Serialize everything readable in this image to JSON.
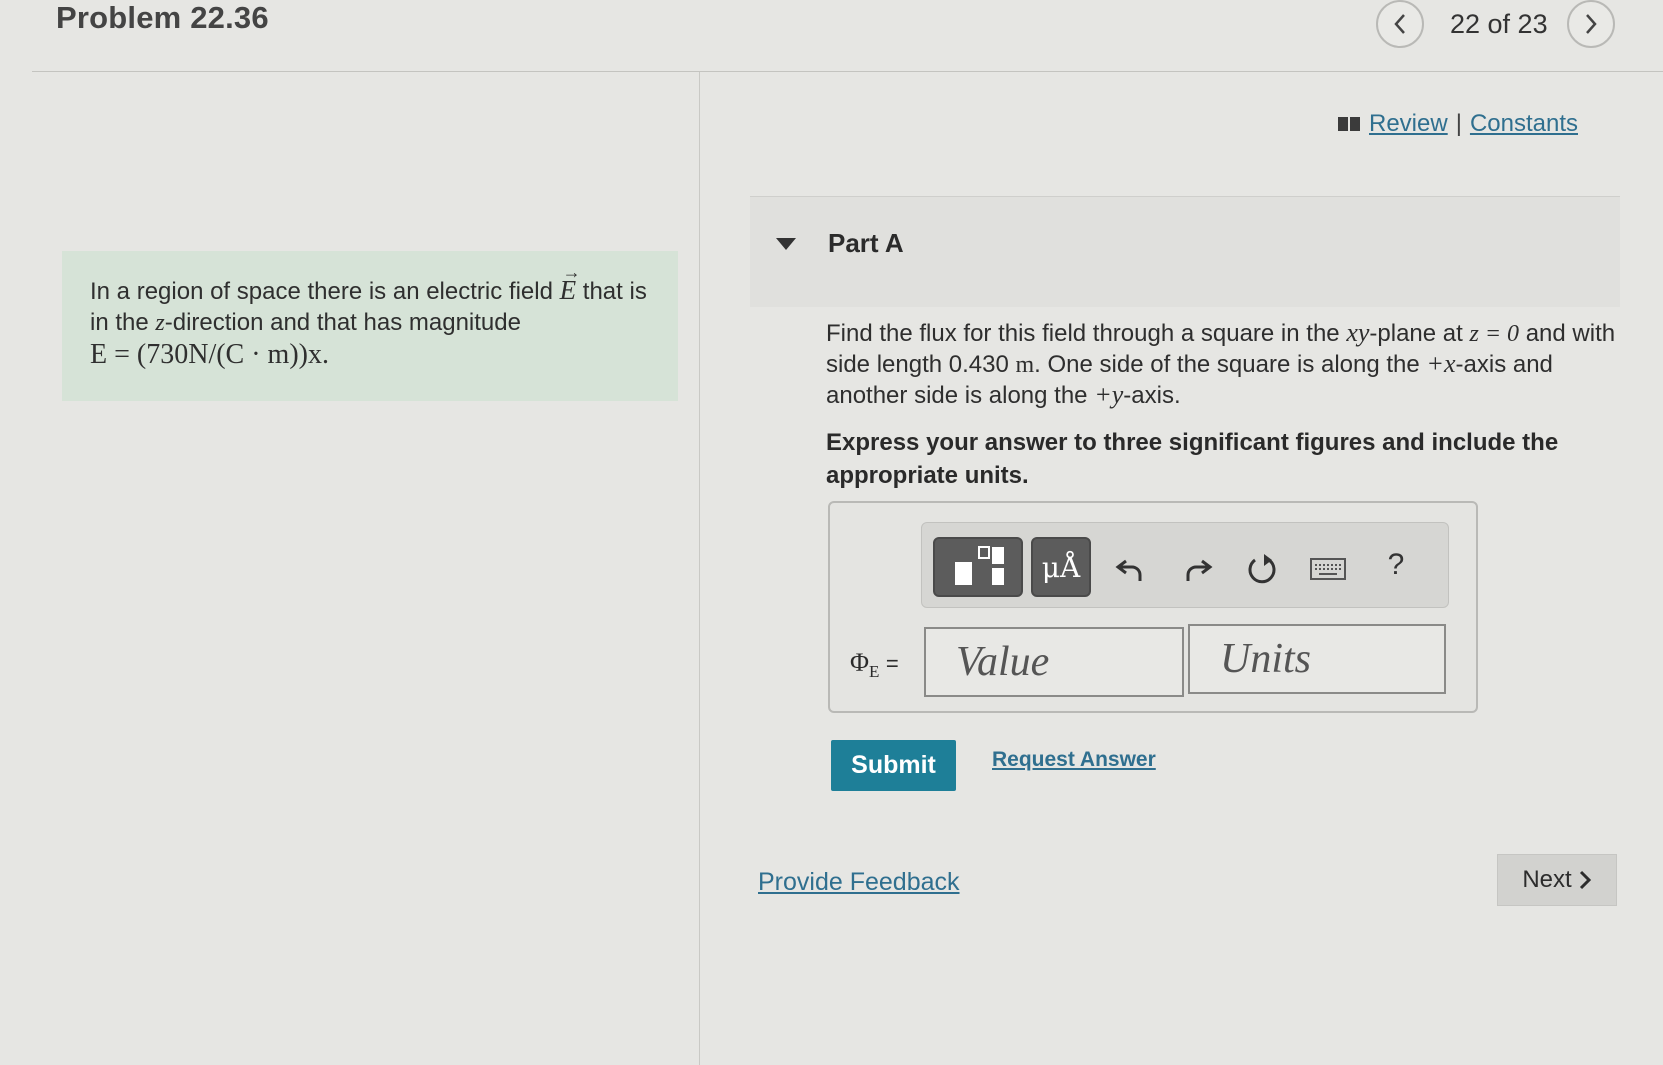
{
  "header": {
    "title": "Problem 22.36",
    "pager": "22 of 23"
  },
  "problem": {
    "text_before": "In a region of space there is an electric field",
    "field_symbol": "E",
    "text_after_symbol": "that is in the",
    "z_var": "z",
    "text_direction": "-direction and that has magnitude",
    "equation": "E = (730N/(C · m))x."
  },
  "links": {
    "review": "Review",
    "separator": "|",
    "constants": "Constants"
  },
  "partA": {
    "label": "Part A",
    "question": {
      "p1": "Find the flux for this field through a square in the",
      "xy": "xy",
      "p2": "-plane at",
      "z_eq": "z = 0",
      "p3": "and with side length 0.430",
      "unit_m": "m",
      "p4": ". One side of the square is along the",
      "plus_x": "+x",
      "p5": "-axis and another side is along the",
      "plus_y": "+y",
      "p6": "-axis."
    },
    "instruction": "Express your answer to three significant figures and include the appropriate units.",
    "toolbar": {
      "units_symbol": "μÅ",
      "help": "?"
    },
    "answer_label": "Φ",
    "answer_sub": "E",
    "answer_eq": "=",
    "value_placeholder": "Value",
    "units_placeholder": "Units",
    "submit": "Submit",
    "request_answer": "Request Answer"
  },
  "footer": {
    "feedback": "Provide Feedback",
    "next": "Next"
  }
}
